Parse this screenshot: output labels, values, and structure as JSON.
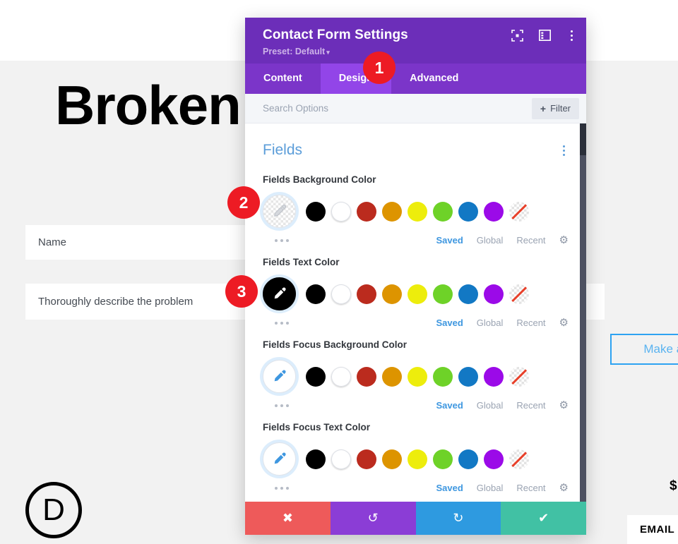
{
  "background": {
    "heading": "Broken Contact",
    "fields": [
      {
        "name": "name-field",
        "placeholder": "Name"
      },
      {
        "name": "message-field",
        "placeholder": "Thoroughly describe the problem"
      }
    ],
    "submit_button": "Make an",
    "logo_letter": "D",
    "price_text": "$",
    "email_label": "EMAIL"
  },
  "modal": {
    "title": "Contact Form Settings",
    "preset": "Preset: Default",
    "preset_caret": "▾",
    "header_icons": [
      {
        "name": "fullscreen-icon"
      },
      {
        "name": "layout-split-icon"
      },
      {
        "name": "more-options-icon"
      }
    ],
    "tabs": [
      {
        "label": "Content",
        "active": false
      },
      {
        "label": "Design",
        "active": true
      },
      {
        "label": "Advanced",
        "active": false
      }
    ],
    "search": {
      "placeholder": "Search Options",
      "value": ""
    },
    "filter_button": {
      "label": "Filter",
      "plus": "+"
    },
    "section": {
      "title": "Fields"
    },
    "palette_tabs": [
      {
        "label": "Saved",
        "active": true
      },
      {
        "label": "Global",
        "active": false
      },
      {
        "label": "Recent",
        "active": false
      }
    ],
    "swatch_colors": [
      {
        "name": "black",
        "hex": "#000000"
      },
      {
        "name": "white",
        "hex": "#ffffff"
      },
      {
        "name": "red",
        "hex": "#bb2b1e"
      },
      {
        "name": "orange",
        "hex": "#dd9400"
      },
      {
        "name": "yellow",
        "hex": "#eded0c"
      },
      {
        "name": "green",
        "hex": "#6ed228"
      },
      {
        "name": "blue",
        "hex": "#1278c4"
      },
      {
        "name": "purple",
        "hex": "#9b0ae8"
      },
      {
        "name": "none",
        "hex": "transparent"
      }
    ],
    "options": [
      {
        "label": "Fields Background Color",
        "selected_color": "transparent"
      },
      {
        "label": "Fields Text Color",
        "selected_color": "#000000"
      },
      {
        "label": "Fields Focus Background Color",
        "selected_color": "#ffffff"
      },
      {
        "label": "Fields Focus Text Color",
        "selected_color": "#ffffff"
      }
    ],
    "footer_buttons": [
      {
        "name": "cancel-button",
        "glyph": "✖"
      },
      {
        "name": "undo-button",
        "glyph": "↺"
      },
      {
        "name": "redo-button",
        "glyph": "↻"
      },
      {
        "name": "save-button",
        "glyph": "✔"
      }
    ]
  },
  "badges": [
    {
      "number": "1"
    },
    {
      "number": "2"
    },
    {
      "number": "3"
    }
  ],
  "colors": {
    "modal_header": "#6c2eb9",
    "tab_active": "#9245e8",
    "badge_red": "#ed1b24",
    "accent_blue": "#3e97e0"
  }
}
